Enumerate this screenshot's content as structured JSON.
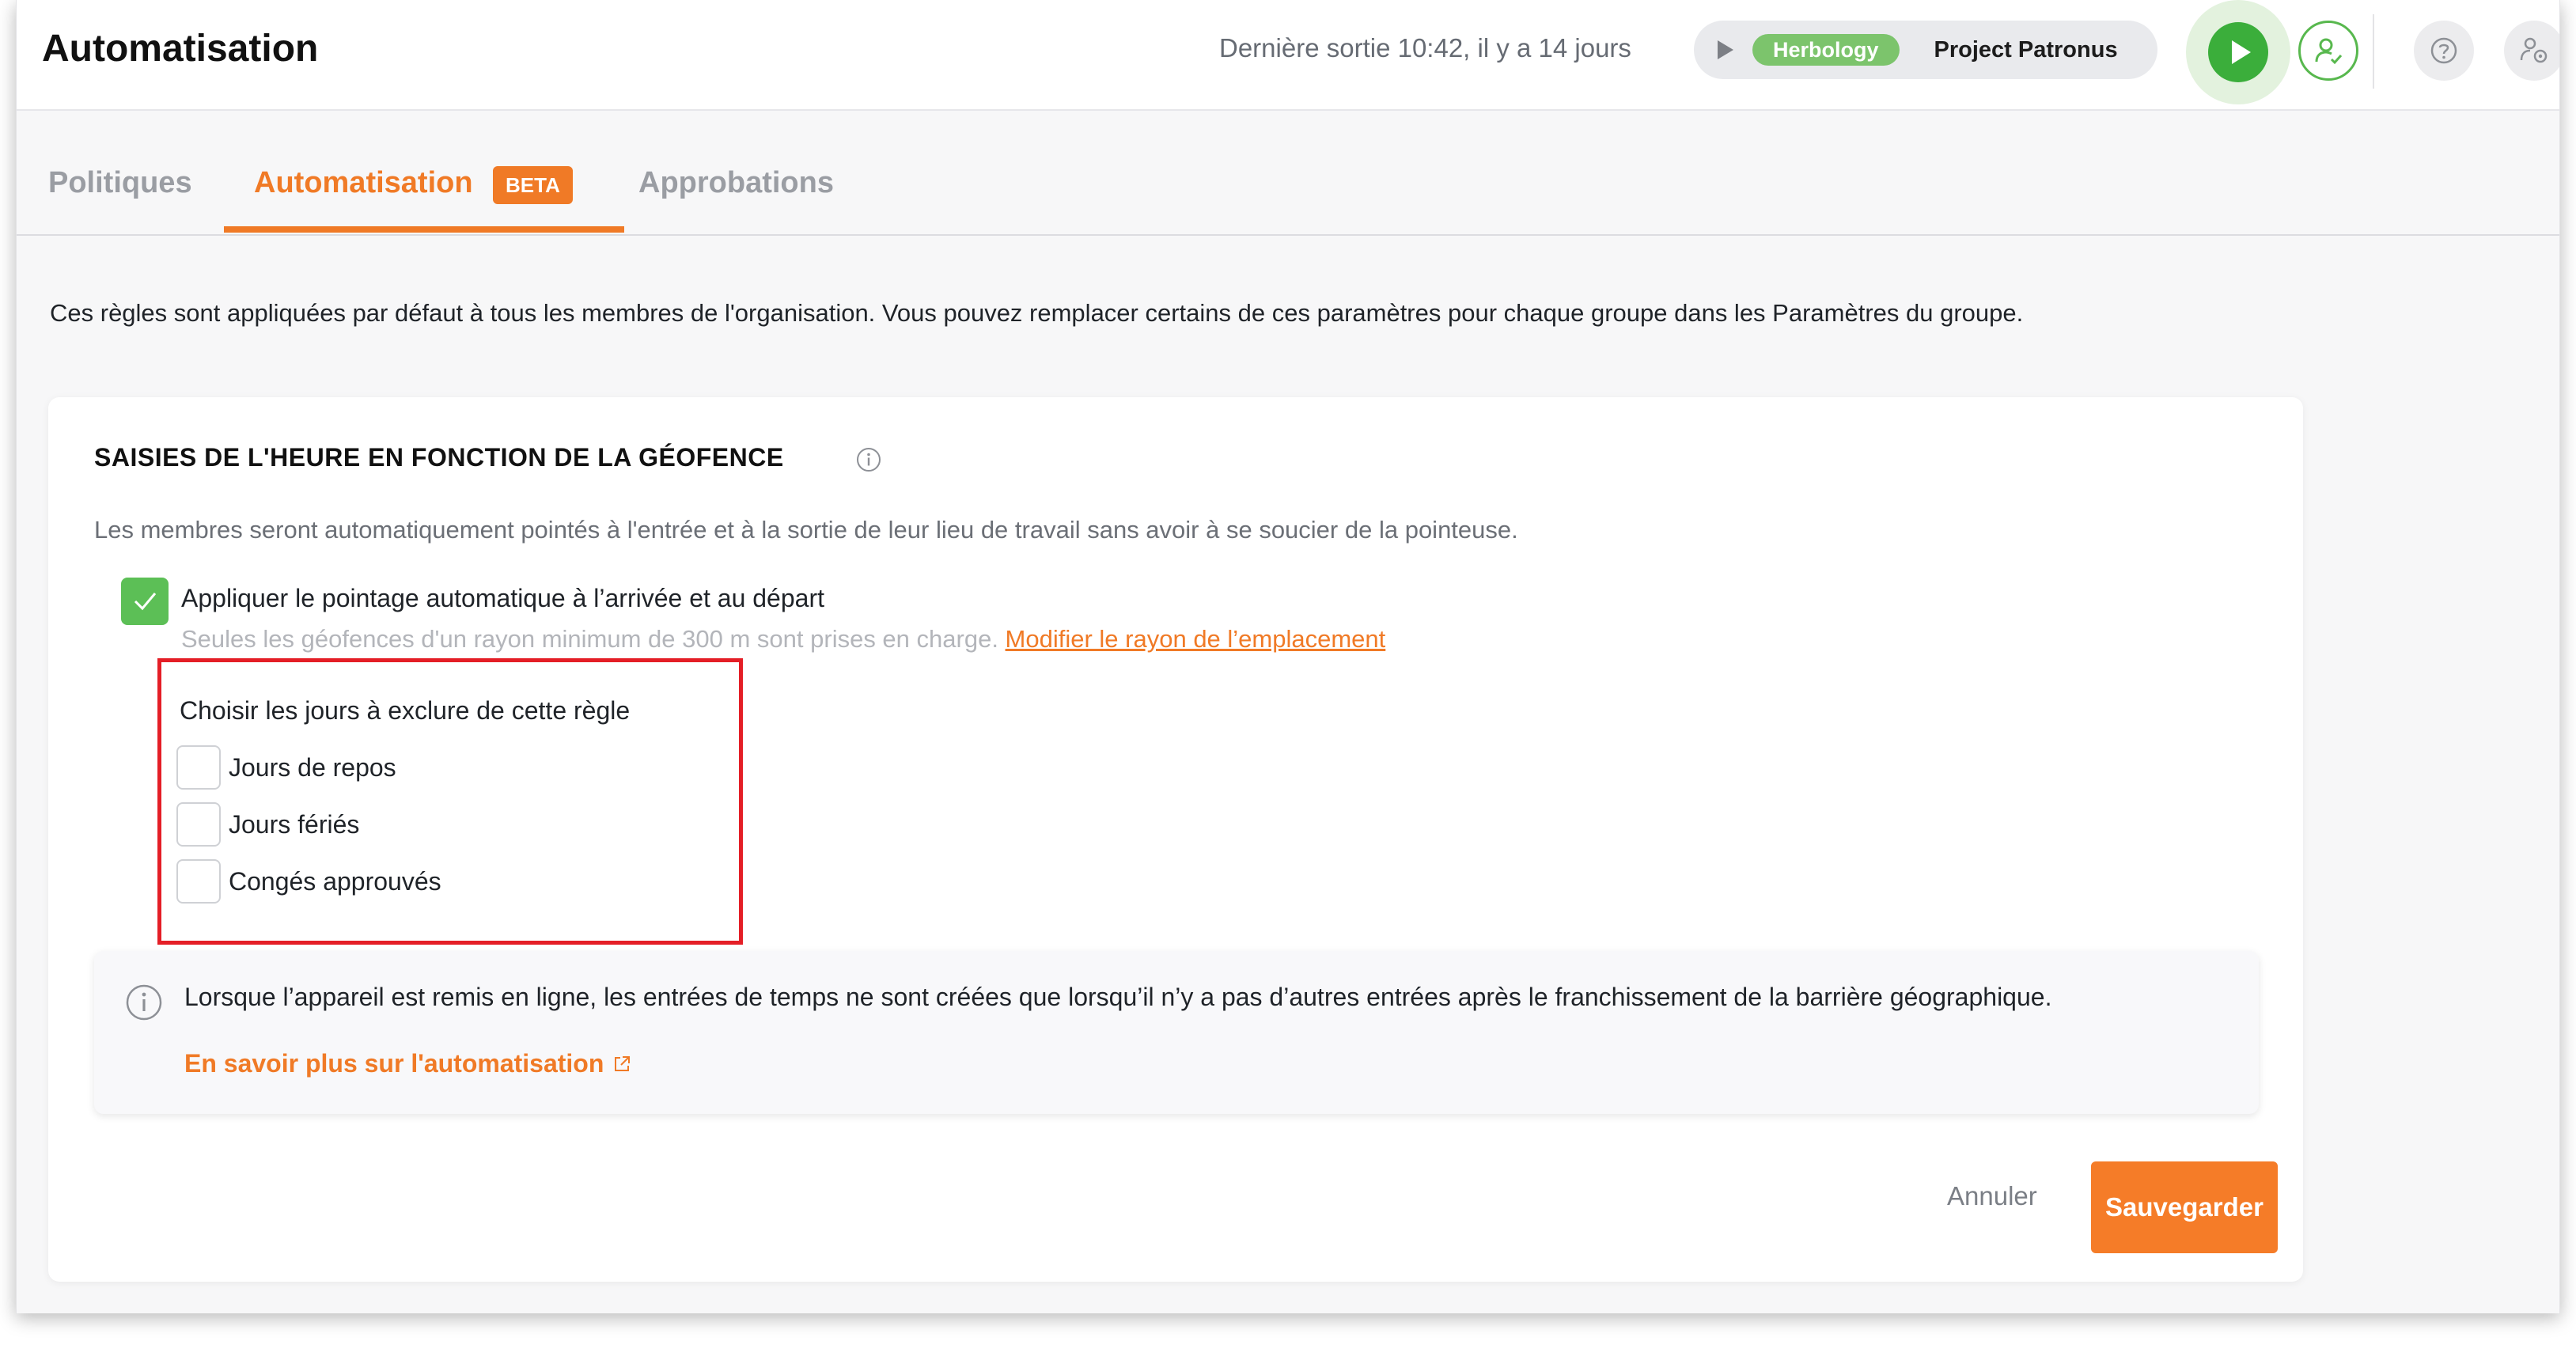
{
  "header": {
    "title": "Automatisation",
    "last_exit": "Dernière sortie 10:42, il y a 14 jours",
    "timer": {
      "project_badge": "Herbology",
      "project_name": "Project Patronus"
    }
  },
  "tabs": [
    {
      "label": "Politiques"
    },
    {
      "label": "Automatisation",
      "badge": "BETA",
      "active": true
    },
    {
      "label": "Approbations"
    }
  ],
  "intro": "Ces règles sont appliquées par défaut à tous les membres de l'organisation. Vous pouvez remplacer certains de ces paramètres pour chaque groupe dans les Paramètres du groupe.",
  "card": {
    "title": "SAISIES DE L'HEURE EN FONCTION DE LA GÉOFENCE",
    "description": "Les membres seront automatiquement pointés à l'entrée et à la sortie de leur lieu de travail sans avoir à se soucier de la pointeuse.",
    "apply_label": "Appliquer le pointage automatique à l’arrivée et au départ",
    "apply_checked": true,
    "radius_note": "Seules les géofences d'un rayon minimum de 300 m sont prises en charge. ",
    "radius_link": "Modifier le rayon de l’emplacement",
    "exclude_title": "Choisir les jours à exclure de cette règle",
    "exclude_days": [
      {
        "label": "Jours de repos",
        "checked": false
      },
      {
        "label": "Jours fériés",
        "checked": false
      },
      {
        "label": "Congés approuvés",
        "checked": false
      }
    ],
    "info_text": "Lorsque l’appareil est remis en ligne, les entrées de temps ne sont créées que lorsqu’il n’y a pas d’autres entrées après le franchissement de la barrière géographique.",
    "learn_more": "En savoir plus sur l'automatisation",
    "cancel_label": "Annuler",
    "save_label": "Sauvegarder"
  },
  "colors": {
    "accent": "#f07a26",
    "success": "#5cbf56",
    "highlight_box": "#e41e26"
  }
}
